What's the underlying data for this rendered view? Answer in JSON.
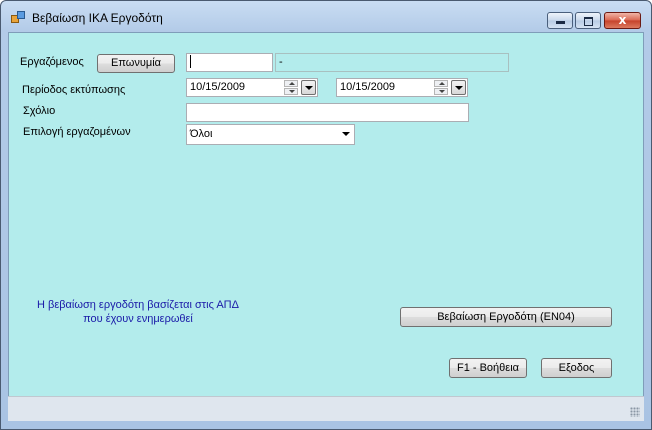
{
  "window": {
    "title": "Βεβαίωση ΙΚΑ Εργοδότη"
  },
  "titlebar_buttons": {
    "close_symbol": "x"
  },
  "form": {
    "employee_label": "Εργαζόμενος",
    "surname_button": "Επωνυμία",
    "employee_code_value": "",
    "employee_name_value": "-",
    "print_period_label": "Περίοδος εκτύπωσης",
    "date_from": "10/15/2009",
    "date_to": "10/15/2009",
    "comment_label": "Σχόλιο",
    "comment_value": "",
    "select_employees_label": "Επιλογή εργαζομένων",
    "select_employees_value": "Όλοι"
  },
  "info_note": {
    "line1": "Η βεβαίωση εργοδότη βασίζεται στις ΑΠΔ",
    "line2": "που έχουν ενημερωθεί"
  },
  "actions": {
    "certificate_button": "Βεβαίωση Εργοδότη (ΕΝ04)",
    "help_button": "F1 - Βοήθεια",
    "exit_button": "Εξοδος"
  },
  "colors": {
    "client_background": "#b3ecec",
    "note_text": "#1a1aa8",
    "title_bar": "#b3cbe8",
    "close_button": "#c5412a"
  }
}
